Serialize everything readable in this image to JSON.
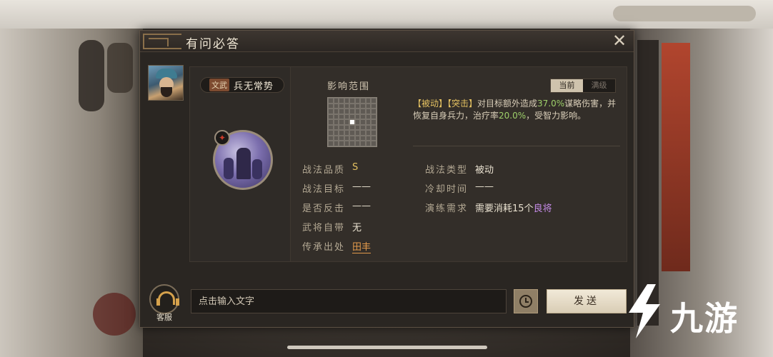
{
  "dialog": {
    "title": "有问必答",
    "close_icon": "close-icon"
  },
  "hero": {
    "avatar_icon": "hero-portrait"
  },
  "skill": {
    "type_badge": "文武",
    "name": "兵无常势"
  },
  "detail": {
    "range_label": "影响范围",
    "tabs": [
      "当前",
      "满级"
    ],
    "active_tab": "当前",
    "description": {
      "tag1": "【被动】",
      "tag2": "【突击】",
      "text1": "对目标额外造成",
      "value1": "37.0%",
      "text2": "谋略伤害，并恢复自身兵力，治疗率",
      "value2": "20.0%",
      "text3": "，受智力影响。"
    },
    "attributes": {
      "quality_label": "战法品质",
      "quality_value": "S",
      "type_label": "战法类型",
      "type_value": "被动",
      "target_label": "战法目标",
      "target_value": "——",
      "cooldown_label": "冷却时间",
      "cooldown_value": "——",
      "counter_label": "是否反击",
      "counter_value": "——",
      "practice_label": "演练需求",
      "practice_value_prefix": "需要消耗",
      "practice_value_count": "15个",
      "practice_value_item": "良将",
      "self_carry_label": "武将自带",
      "self_carry_value": "无",
      "inherit_label": "传承出处",
      "inherit_value": "田丰"
    }
  },
  "input_bar": {
    "service_label": "客服",
    "placeholder": "点击输入文字",
    "send_label": "发送"
  },
  "watermark": {
    "text": "九游"
  },
  "colors": {
    "gold": "#e3c061",
    "green": "#9ed06a",
    "purple": "#c48ae6",
    "link": "#e39a4b"
  }
}
